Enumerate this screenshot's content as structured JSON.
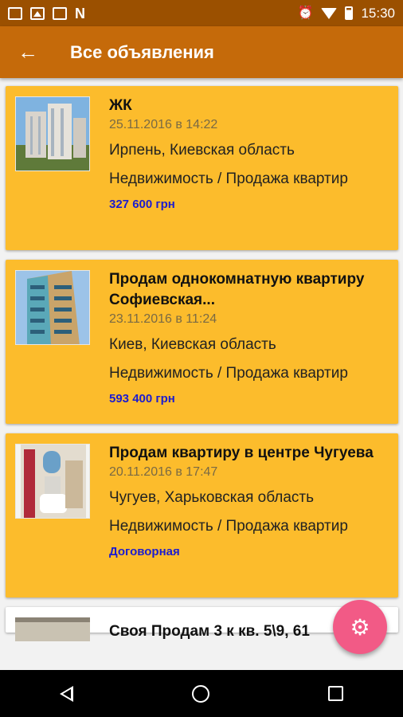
{
  "status_bar": {
    "time": "15:30",
    "left_icons": [
      "mail-icon",
      "image-icon",
      "mail-icon",
      "n-icon"
    ],
    "right_icons": [
      "alarm-icon",
      "wifi-icon",
      "battery-icon"
    ]
  },
  "app_bar": {
    "back_icon": "arrow-left-icon",
    "title": "Все объявления"
  },
  "listings": [
    {
      "title": "ЖК",
      "date": "25.11.2016 в 14:22",
      "city": "Ирпень, Киевская область",
      "category": "Недвижимость / Продажа квартир",
      "price": "327 600 грн"
    },
    {
      "title": "Продам однокомнатную квартиру Софиевская...",
      "date": "23.11.2016 в 11:24",
      "city": "Киев, Киевская область",
      "category": "Недвижимость / Продажа квартир",
      "price": "593 400 грн"
    },
    {
      "title": "Продам квартиру в центре Чугуева",
      "date": "20.11.2016 в 17:47",
      "city": "Чугуев, Харьковская область",
      "category": "Недвижимость / Продажа квартир",
      "price": "Договорная"
    },
    {
      "title": "Своя Продам 3 к кв. 5\\9, 61"
    }
  ],
  "fab": {
    "icon": "gear-icon"
  },
  "colors": {
    "status_bar": "#9b5000",
    "app_bar": "#c56a0a",
    "card": "#fcbc2c",
    "price": "#1c1ccf",
    "fab": "#f25a86"
  }
}
